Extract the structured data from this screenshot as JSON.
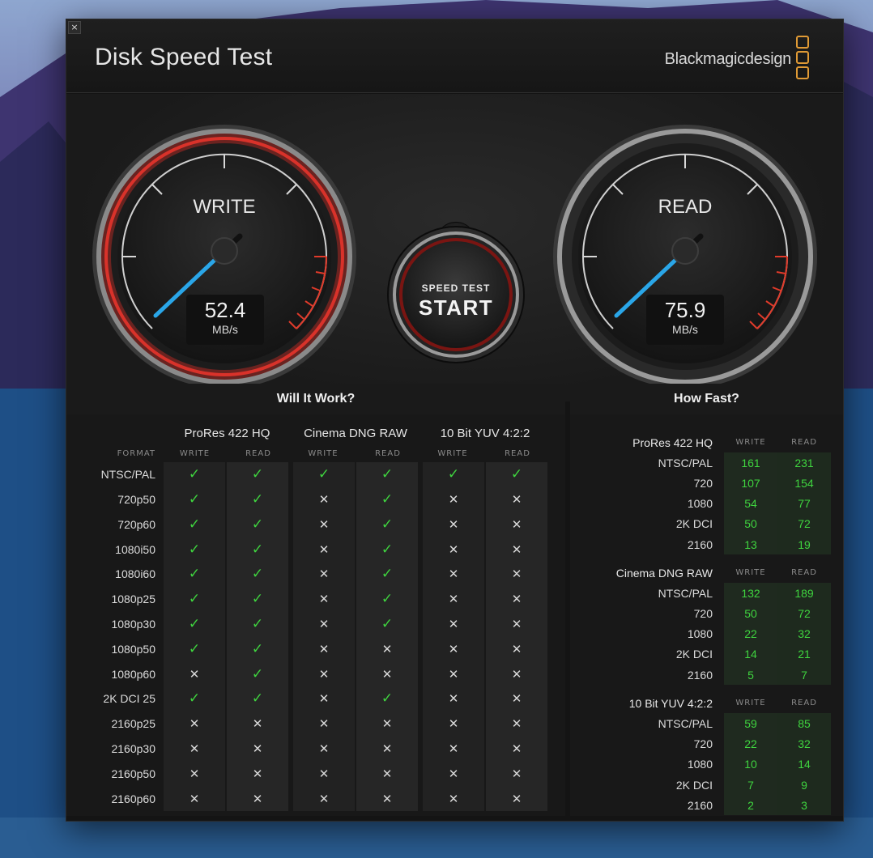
{
  "window": {
    "close_glyph": "×",
    "title": "Disk Speed Test",
    "brand": "Blackmagicdesign"
  },
  "gauges": {
    "write": {
      "label": "WRITE",
      "value": "52.4",
      "unit": "MB/s",
      "level": 52.4
    },
    "read": {
      "label": "READ",
      "value": "75.9",
      "unit": "MB/s",
      "level": 75.9
    }
  },
  "start_button": {
    "line1": "SPEED TEST",
    "line2": "START"
  },
  "will_it_work": {
    "title": "Will It Work?",
    "format_label": "FORMAT",
    "groups": [
      "ProRes 422 HQ",
      "Cinema DNG RAW",
      "10 Bit YUV 4:2:2"
    ],
    "sub_write": "WRITE",
    "sub_read": "READ",
    "rows": [
      {
        "format": "NTSC/PAL",
        "marks": [
          1,
          1,
          1,
          1,
          1,
          1
        ]
      },
      {
        "format": "720p50",
        "marks": [
          1,
          1,
          0,
          1,
          0,
          0
        ]
      },
      {
        "format": "720p60",
        "marks": [
          1,
          1,
          0,
          1,
          0,
          0
        ]
      },
      {
        "format": "1080i50",
        "marks": [
          1,
          1,
          0,
          1,
          0,
          0
        ]
      },
      {
        "format": "1080i60",
        "marks": [
          1,
          1,
          0,
          1,
          0,
          0
        ]
      },
      {
        "format": "1080p25",
        "marks": [
          1,
          1,
          0,
          1,
          0,
          0
        ]
      },
      {
        "format": "1080p30",
        "marks": [
          1,
          1,
          0,
          1,
          0,
          0
        ]
      },
      {
        "format": "1080p50",
        "marks": [
          1,
          1,
          0,
          0,
          0,
          0
        ]
      },
      {
        "format": "1080p60",
        "marks": [
          0,
          1,
          0,
          0,
          0,
          0
        ]
      },
      {
        "format": "2K DCI 25",
        "marks": [
          1,
          1,
          0,
          1,
          0,
          0
        ]
      },
      {
        "format": "2160p25",
        "marks": [
          0,
          0,
          0,
          0,
          0,
          0
        ]
      },
      {
        "format": "2160p30",
        "marks": [
          0,
          0,
          0,
          0,
          0,
          0
        ]
      },
      {
        "format": "2160p50",
        "marks": [
          0,
          0,
          0,
          0,
          0,
          0
        ]
      },
      {
        "format": "2160p60",
        "marks": [
          0,
          0,
          0,
          0,
          0,
          0
        ]
      }
    ],
    "check_glyph": "✓",
    "cross_glyph": "✕"
  },
  "how_fast": {
    "title": "How Fast?",
    "sub_write": "WRITE",
    "sub_read": "READ",
    "groups": [
      {
        "name": "ProRes 422 HQ",
        "rows": [
          {
            "label": "NTSC/PAL",
            "write": "161",
            "read": "231"
          },
          {
            "label": "720",
            "write": "107",
            "read": "154"
          },
          {
            "label": "1080",
            "write": "54",
            "read": "77"
          },
          {
            "label": "2K DCI",
            "write": "50",
            "read": "72"
          },
          {
            "label": "2160",
            "write": "13",
            "read": "19"
          }
        ]
      },
      {
        "name": "Cinema DNG RAW",
        "rows": [
          {
            "label": "NTSC/PAL",
            "write": "132",
            "read": "189"
          },
          {
            "label": "720",
            "write": "50",
            "read": "72"
          },
          {
            "label": "1080",
            "write": "22",
            "read": "32"
          },
          {
            "label": "2K DCI",
            "write": "14",
            "read": "21"
          },
          {
            "label": "2160",
            "write": "5",
            "read": "7"
          }
        ]
      },
      {
        "name": "10 Bit YUV 4:2:2",
        "rows": [
          {
            "label": "NTSC/PAL",
            "write": "59",
            "read": "85"
          },
          {
            "label": "720",
            "write": "22",
            "read": "32"
          },
          {
            "label": "1080",
            "write": "10",
            "read": "14"
          },
          {
            "label": "2K DCI",
            "write": "7",
            "read": "9"
          },
          {
            "label": "2160",
            "write": "2",
            "read": "3"
          }
        ]
      }
    ]
  },
  "colors": {
    "check": "#3fd43f",
    "accent_red": "#d9322a",
    "needle_blue": "#2aa6e8",
    "brand_orange": "#e09a35"
  }
}
